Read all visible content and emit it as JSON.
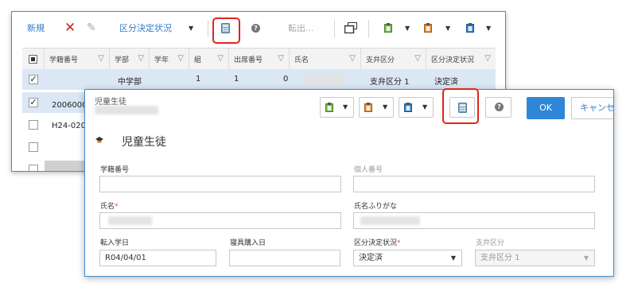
{
  "back": {
    "toolbar": {
      "new_label": "新規",
      "status_label": "区分決定状況",
      "export_label": "転出..."
    },
    "grid": {
      "columns": [
        "学籍番号",
        "学部",
        "学年",
        "組",
        "出席番号",
        "氏名",
        "支弁区分",
        "区分決定状況"
      ],
      "rows": [
        {
          "checked": true,
          "id": "",
          "dept": "中学部",
          "grade": "1",
          "class": "1",
          "seat": "0",
          "name": "",
          "support": "支弁区分 1",
          "status": "決定済"
        },
        {
          "checked": true,
          "id": "2006000",
          "dept": "",
          "grade": "",
          "class": "",
          "seat": "",
          "name": "",
          "support": "",
          "status": ""
        },
        {
          "checked": false,
          "id": "H24-020",
          "dept": "",
          "grade": "",
          "class": "",
          "seat": "",
          "name": "",
          "support": "",
          "status": ""
        },
        {
          "checked": false,
          "id": "",
          "dept": "",
          "grade": "",
          "class": "",
          "seat": "",
          "name": "",
          "support": "",
          "status": ""
        }
      ]
    }
  },
  "front": {
    "window_title": "児童生徒",
    "ok_label": "OK",
    "cancel_label": "キャンセ",
    "section_title": "児童生徒",
    "fields": {
      "student_no_label": "学籍番号",
      "personal_no_label": "個人番号",
      "name_label": "氏名",
      "kana_label": "氏名ふりがな",
      "transfer_date_label": "転入学日",
      "uniform_date_label": "寝具購入日",
      "status_label": "区分決定状況",
      "support_label": "支弁区分",
      "transfer_date_value": "R04/04/01",
      "status_value": "決定済",
      "support_value": "支弁区分 1"
    }
  },
  "colors": {
    "accent": "#3d8fd6",
    "ok_button": "#2f86d6",
    "highlight": "#e0251f",
    "delete_icon": "#d0261e"
  }
}
